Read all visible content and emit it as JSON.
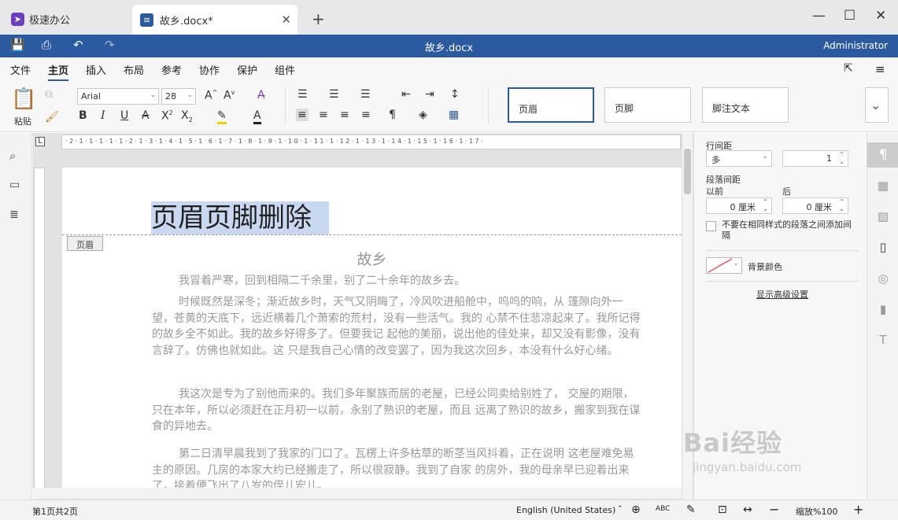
{
  "tabs": {
    "home_tab": "极速办公",
    "doc_tab": "故乡.docx*"
  },
  "titlebar": {
    "title": "故乡.docx",
    "user": "Administrator"
  },
  "menu": [
    "文件",
    "主页",
    "插入",
    "布局",
    "参考",
    "协作",
    "保护",
    "组件"
  ],
  "toolbar": {
    "paste_label": "粘贴",
    "font_name": "Arial",
    "font_size": "28",
    "styles": [
      "页眉",
      "页脚",
      "脚注文本"
    ]
  },
  "document": {
    "header_text": "页眉页脚删除",
    "header_tag": "页眉",
    "title": "故乡",
    "paragraphs": [
      "我冒着严寒，回到相隔二千余里，别了二十余年的故乡去。",
      "时候既然是深冬；渐近故乡时，天气又阴晦了，冷风吹进船舱中，呜呜的响，从 篷隙向外一望，苍黄的天底下，远近横着几个萧索的荒村，没有一些活气。我的 心禁不住悲凉起来了。我所记得的故乡全不如此。我的故乡好得多了。但要我记 起他的美丽，说出他的佳处来，却又没有影像，没有言辞了。仿佛也就如此。这 只是我自己心情的改变罢了，因为我这次回乡，本没有什么好心绪。",
      "我这次是专为了别他而来的。我们多年聚族而居的老屋，已经公同卖给别姓了， 交屋的期限，只在本年，所以必须赶在正月初一以前，永别了熟识的老屋，而且 远离了熟识的故乡，搬家到我在谋食的异地去。",
      "第二日清早晨我到了我家的门口了。瓦楞上许多枯草的断茎当风抖着，正在说明 这老屋难免易主的原因。几房的本家大约已经搬走了，所以很寂静。我到了自家 的房外，我的母亲早已迎着出来了，接着便飞出了八岁的侄儿宏儿。"
    ]
  },
  "panel": {
    "line_spacing_label": "行间距",
    "line_spacing_mode": "多",
    "line_spacing_value": "1",
    "para_spacing_label": "段落间距",
    "before_label": "以前",
    "after_label": "后",
    "before_value": "0 厘米",
    "after_value": "0 厘米",
    "no_space_checkbox": "不要在相同样式的段落之间添加间隔",
    "bg_color_label": "背景颜色",
    "advanced_link": "显示高级设置"
  },
  "status": {
    "page_info": "第1页共2页",
    "language": "English (United States)",
    "zoom": "缩放%100"
  },
  "watermark": {
    "brand": "Bai经验",
    "url": "jingyan.baidu.com"
  },
  "colors": {
    "accent": "#2c5aa0",
    "header_highlight": "#c9d8f0"
  }
}
